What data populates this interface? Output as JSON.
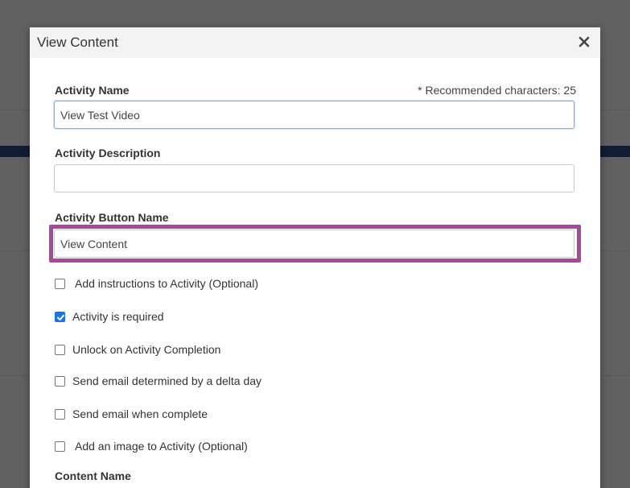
{
  "modal": {
    "title": "View Content",
    "close_glyph": "✕"
  },
  "form": {
    "activity_name": {
      "label": "Activity Name",
      "hint": "* Recommended characters: 25",
      "value": "View Test Video"
    },
    "activity_description": {
      "label": "Activity Description",
      "value": ""
    },
    "activity_button_name": {
      "label": "Activity Button Name",
      "value": "View Content"
    },
    "checkboxes": [
      {
        "label": "Add instructions to Activity (Optional)",
        "checked": false
      },
      {
        "label": "Activity is required",
        "checked": true
      },
      {
        "label": "Unlock on Activity Completion",
        "checked": false
      },
      {
        "label": "Send email determined by a delta day",
        "checked": false
      },
      {
        "label": "Send email when complete",
        "checked": false
      },
      {
        "label": "Add an image to Activity (Optional)",
        "checked": false
      }
    ],
    "content_name": {
      "label": "Content Name"
    }
  },
  "colors": {
    "highlight_border": "#a9479c",
    "checkbox_checked": "#1a73e8",
    "focus_border": "#7fb0e6",
    "background_band": "#2a4d8c"
  }
}
